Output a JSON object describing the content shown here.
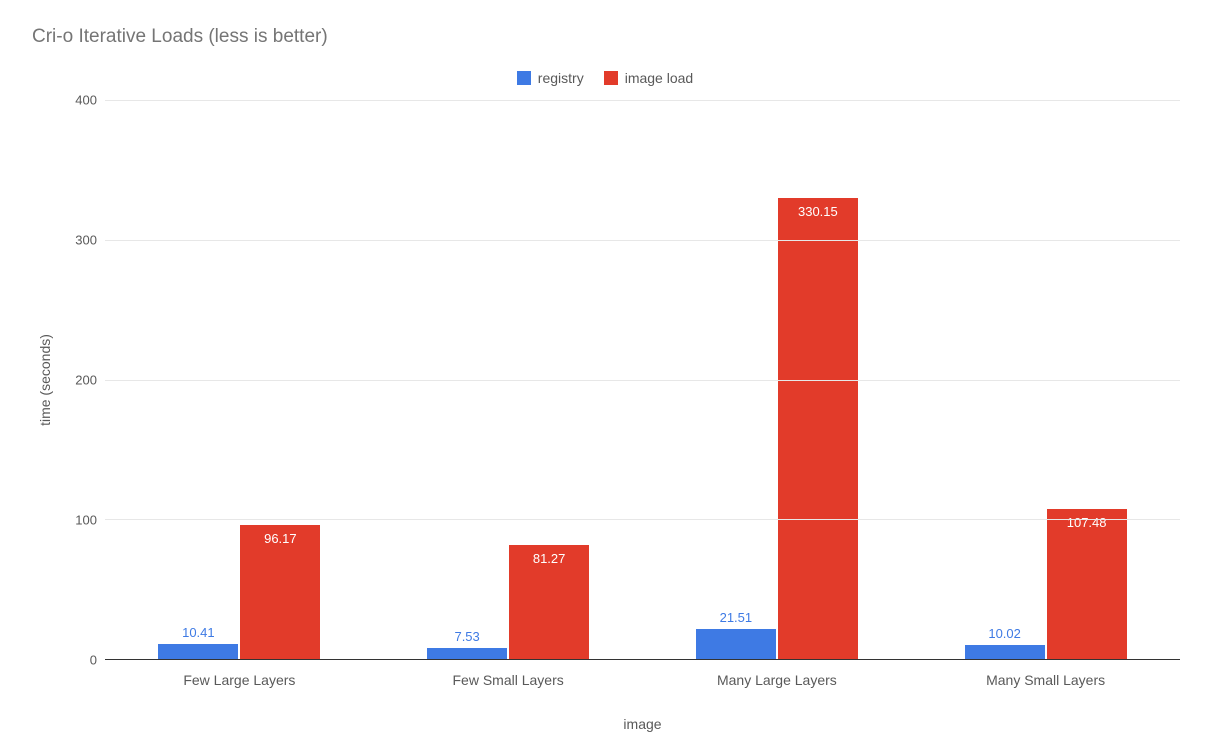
{
  "chart_data": {
    "type": "bar",
    "title": "Cri-o Iterative Loads (less is better)",
    "xlabel": "image",
    "ylabel": "time (seconds)",
    "ylim": [
      0,
      400
    ],
    "yticks": [
      0,
      100,
      200,
      300,
      400
    ],
    "categories": [
      "Few Large Layers",
      "Few Small Layers",
      "Many Large Layers",
      "Many Small Layers"
    ],
    "series": [
      {
        "name": "registry",
        "color": "#3e7ae4",
        "values": [
          10.41,
          7.53,
          21.51,
          10.02
        ]
      },
      {
        "name": "image load",
        "color": "#e23b2a",
        "values": [
          96.17,
          81.27,
          330.15,
          107.48
        ]
      }
    ],
    "legend_position": "top"
  }
}
